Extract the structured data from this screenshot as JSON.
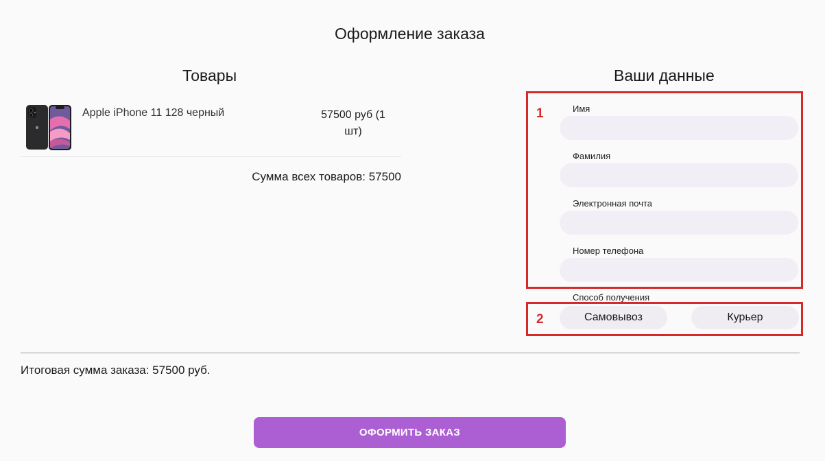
{
  "page_title": "Оформление заказа",
  "goods": {
    "title": "Товары",
    "items": [
      {
        "name": "Apple iPhone 11 128 черный",
        "price": "57500 руб (1 шт)"
      }
    ],
    "sum": "Сумма всех товаров: 57500"
  },
  "customer": {
    "title": "Ваши данные",
    "annotations": [
      "1",
      "2"
    ],
    "fields": {
      "first_name": {
        "label": "Имя",
        "value": ""
      },
      "last_name": {
        "label": "Фамилия",
        "value": ""
      },
      "email": {
        "label": "Электронная почта",
        "value": ""
      },
      "phone": {
        "label": "Номер телефона",
        "value": ""
      }
    },
    "delivery": {
      "label": "Способ получения",
      "options": [
        "Самовывоз",
        "Курьер"
      ]
    }
  },
  "total": "Итоговая сумма заказа: 57500 руб.",
  "submit_label": "ОФОРМИТЬ ЗАКАЗ",
  "colors": {
    "accent": "#ac5fd3",
    "highlight": "#d42a2a",
    "input_bg": "#f1eef5"
  }
}
